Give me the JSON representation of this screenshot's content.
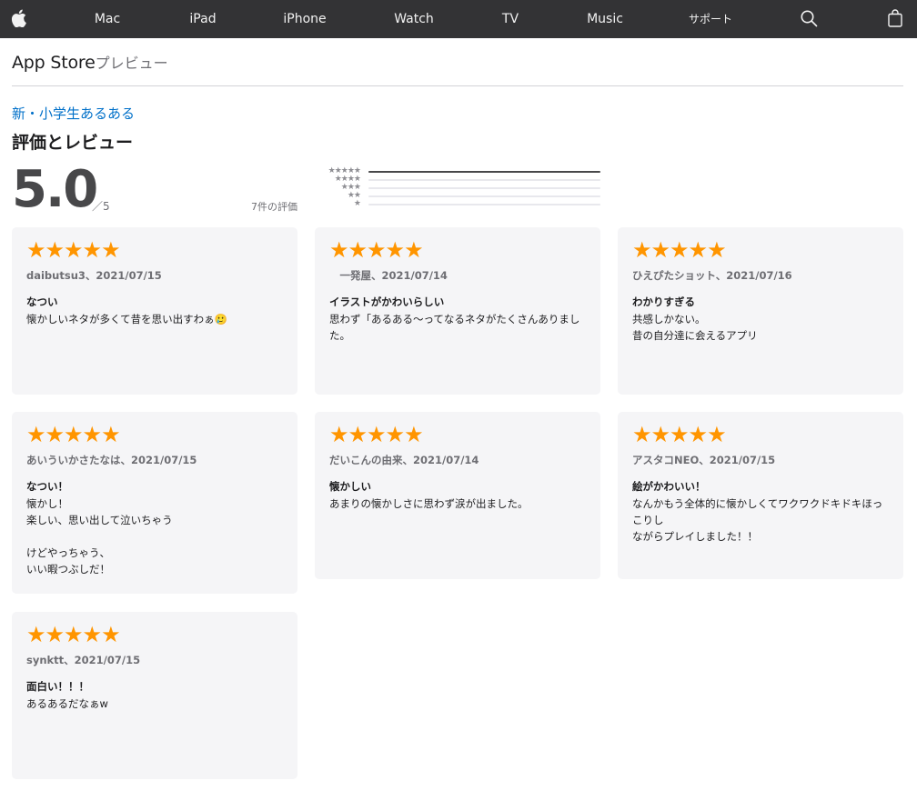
{
  "nav": {
    "items": [
      "Mac",
      "iPad",
      "iPhone",
      "Watch",
      "TV",
      "Music",
      "サポート"
    ]
  },
  "header": {
    "brand": "App Store",
    "preview": "プレビュー"
  },
  "app": {
    "name": "新・小学生あるある"
  },
  "ratings": {
    "section_title": "評価とレビュー",
    "score": "5.0",
    "out_of": "／5",
    "count_label": "7件の評価",
    "histogram": [
      {
        "stars": "★★★★★",
        "fraction": 1.0
      },
      {
        "stars": "★★★★",
        "fraction": 0
      },
      {
        "stars": "★★★",
        "fraction": 0
      },
      {
        "stars": "★★",
        "fraction": 0
      },
      {
        "stars": "★",
        "fraction": 0
      }
    ]
  },
  "reviews": [
    {
      "stars": "★★★★★",
      "meta": "daibutsu3、2021/07/15",
      "title": "なつい",
      "body": "懐かしいネタが多くて昔を思い出すわぁ🥲"
    },
    {
      "stars": "★★★★★",
      "meta": "　一発屋、2021/07/14",
      "title": "イラストがかわいらしい",
      "body": "思わず「あるある〜ってなるネタがたくさんありました。"
    },
    {
      "stars": "★★★★★",
      "meta": "ひえぴたショット、2021/07/16",
      "title": "わかりすぎる",
      "body": "共感しかない。\n昔の自分達に会えるアプリ"
    },
    {
      "stars": "★★★★★",
      "meta": "あいういかさたなは、2021/07/15",
      "title": "なつい！",
      "body": "懐かし！\n楽しい、思い出して泣いちゃう\n\nけどやっちゃう、\nいい暇つぶしだ！"
    },
    {
      "stars": "★★★★★",
      "meta": "だいこんの由来、2021/07/14",
      "title": "懐かしい",
      "body": "あまりの懐かしさに思わず涙が出ました。"
    },
    {
      "stars": "★★★★★",
      "meta": "アスタコNEO、2021/07/15",
      "title": "絵がかわいい！",
      "body": "なんかもう全体的に懐かしくてワクワクドキドキほっこりし\nながらプレイしました！！"
    },
    {
      "stars": "★★★★★",
      "meta": "synktt、2021/07/15",
      "title": "面白い！！！",
      "body": "あるあるだなぁw"
    }
  ]
}
